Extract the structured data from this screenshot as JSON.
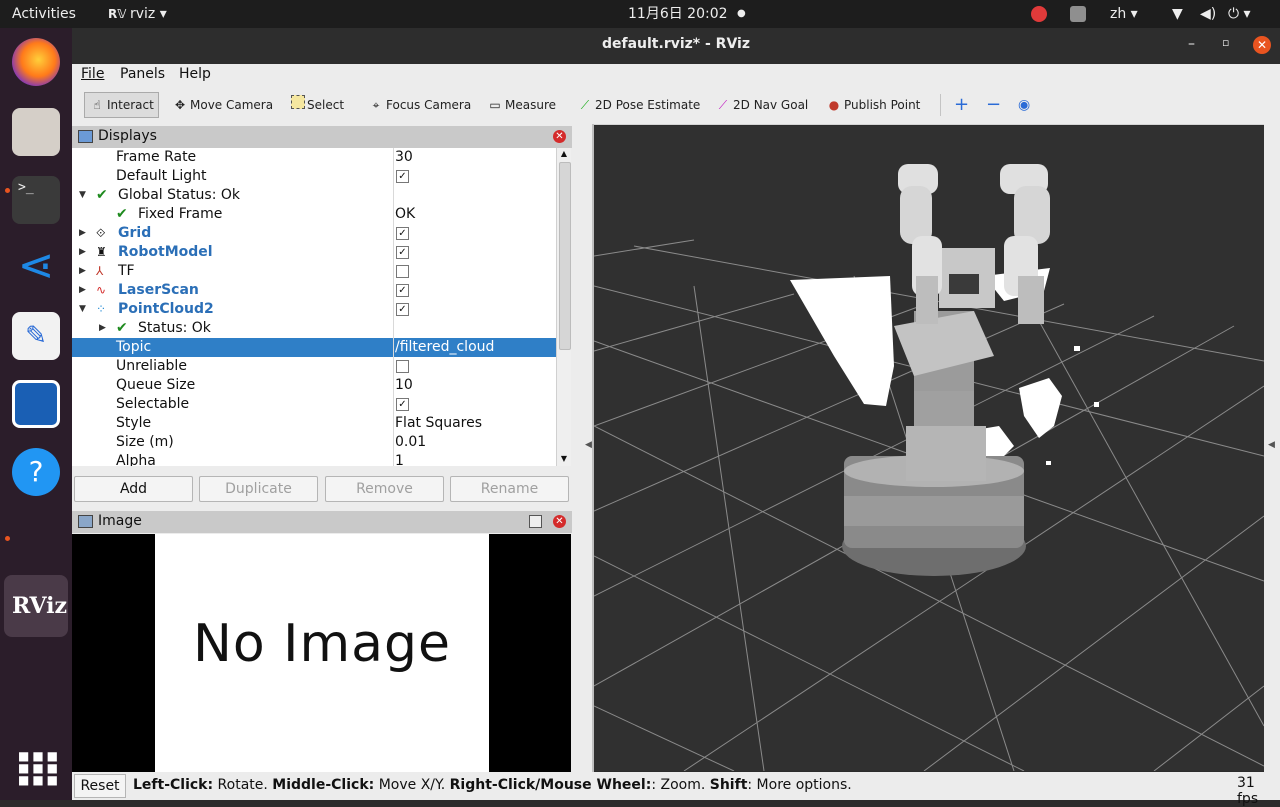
{
  "topbar": {
    "activities": "Activities",
    "app_name": "rviz",
    "clock": "11月6日  20:02",
    "lang": "zh"
  },
  "window": {
    "title": "default.rviz* - RViz"
  },
  "menu": {
    "file": "File",
    "panels": "Panels",
    "help": "Help"
  },
  "toolbar": {
    "interact": "Interact",
    "move_camera": "Move Camera",
    "select": "Select",
    "focus_camera": "Focus Camera",
    "measure": "Measure",
    "pose_estimate": "2D Pose Estimate",
    "nav_goal": "2D Nav Goal",
    "publish_point": "Publish Point"
  },
  "displays": {
    "title": "Displays",
    "rows": [
      {
        "name": "Frame Rate",
        "value": "30"
      },
      {
        "name": "Default Light",
        "checked": true
      },
      {
        "name": "Global Status: Ok",
        "value": ""
      },
      {
        "name": "Fixed Frame",
        "value": "OK"
      },
      {
        "name": "Grid",
        "checked": true
      },
      {
        "name": "RobotModel",
        "checked": true
      },
      {
        "name": "TF",
        "checked": false
      },
      {
        "name": "LaserScan",
        "checked": true
      },
      {
        "name": "PointCloud2",
        "checked": true
      },
      {
        "name": "Status: Ok",
        "value": ""
      },
      {
        "name": "Topic",
        "value": "/filtered_cloud"
      },
      {
        "name": "Unreliable",
        "checked": false
      },
      {
        "name": "Queue Size",
        "value": "10"
      },
      {
        "name": "Selectable",
        "checked": true
      },
      {
        "name": "Style",
        "value": "Flat Squares"
      },
      {
        "name": "Size (m)",
        "value": "0.01"
      },
      {
        "name": "Alpha",
        "value": "1"
      }
    ],
    "buttons": {
      "add": "Add",
      "duplicate": "Duplicate",
      "remove": "Remove",
      "rename": "Rename"
    }
  },
  "image_panel": {
    "title": "Image",
    "placeholder": "No Image"
  },
  "status_bar": {
    "reset": "Reset",
    "k1": "Left-Click:",
    "v1": " Rotate. ",
    "k2": "Middle-Click:",
    "v2": " Move X/Y. ",
    "k3": "Right-Click/Mouse Wheel:",
    "v3": ": Zoom. ",
    "k4": "Shift",
    "v4": ": More options.",
    "fps": "31 fps"
  },
  "colors": {
    "selection": "#2f7fc7",
    "link_blue": "#2b6fb7",
    "ok_green": "#1e8a1e",
    "close_red": "#d42b2b",
    "ubuntu_orange": "#e95420"
  }
}
